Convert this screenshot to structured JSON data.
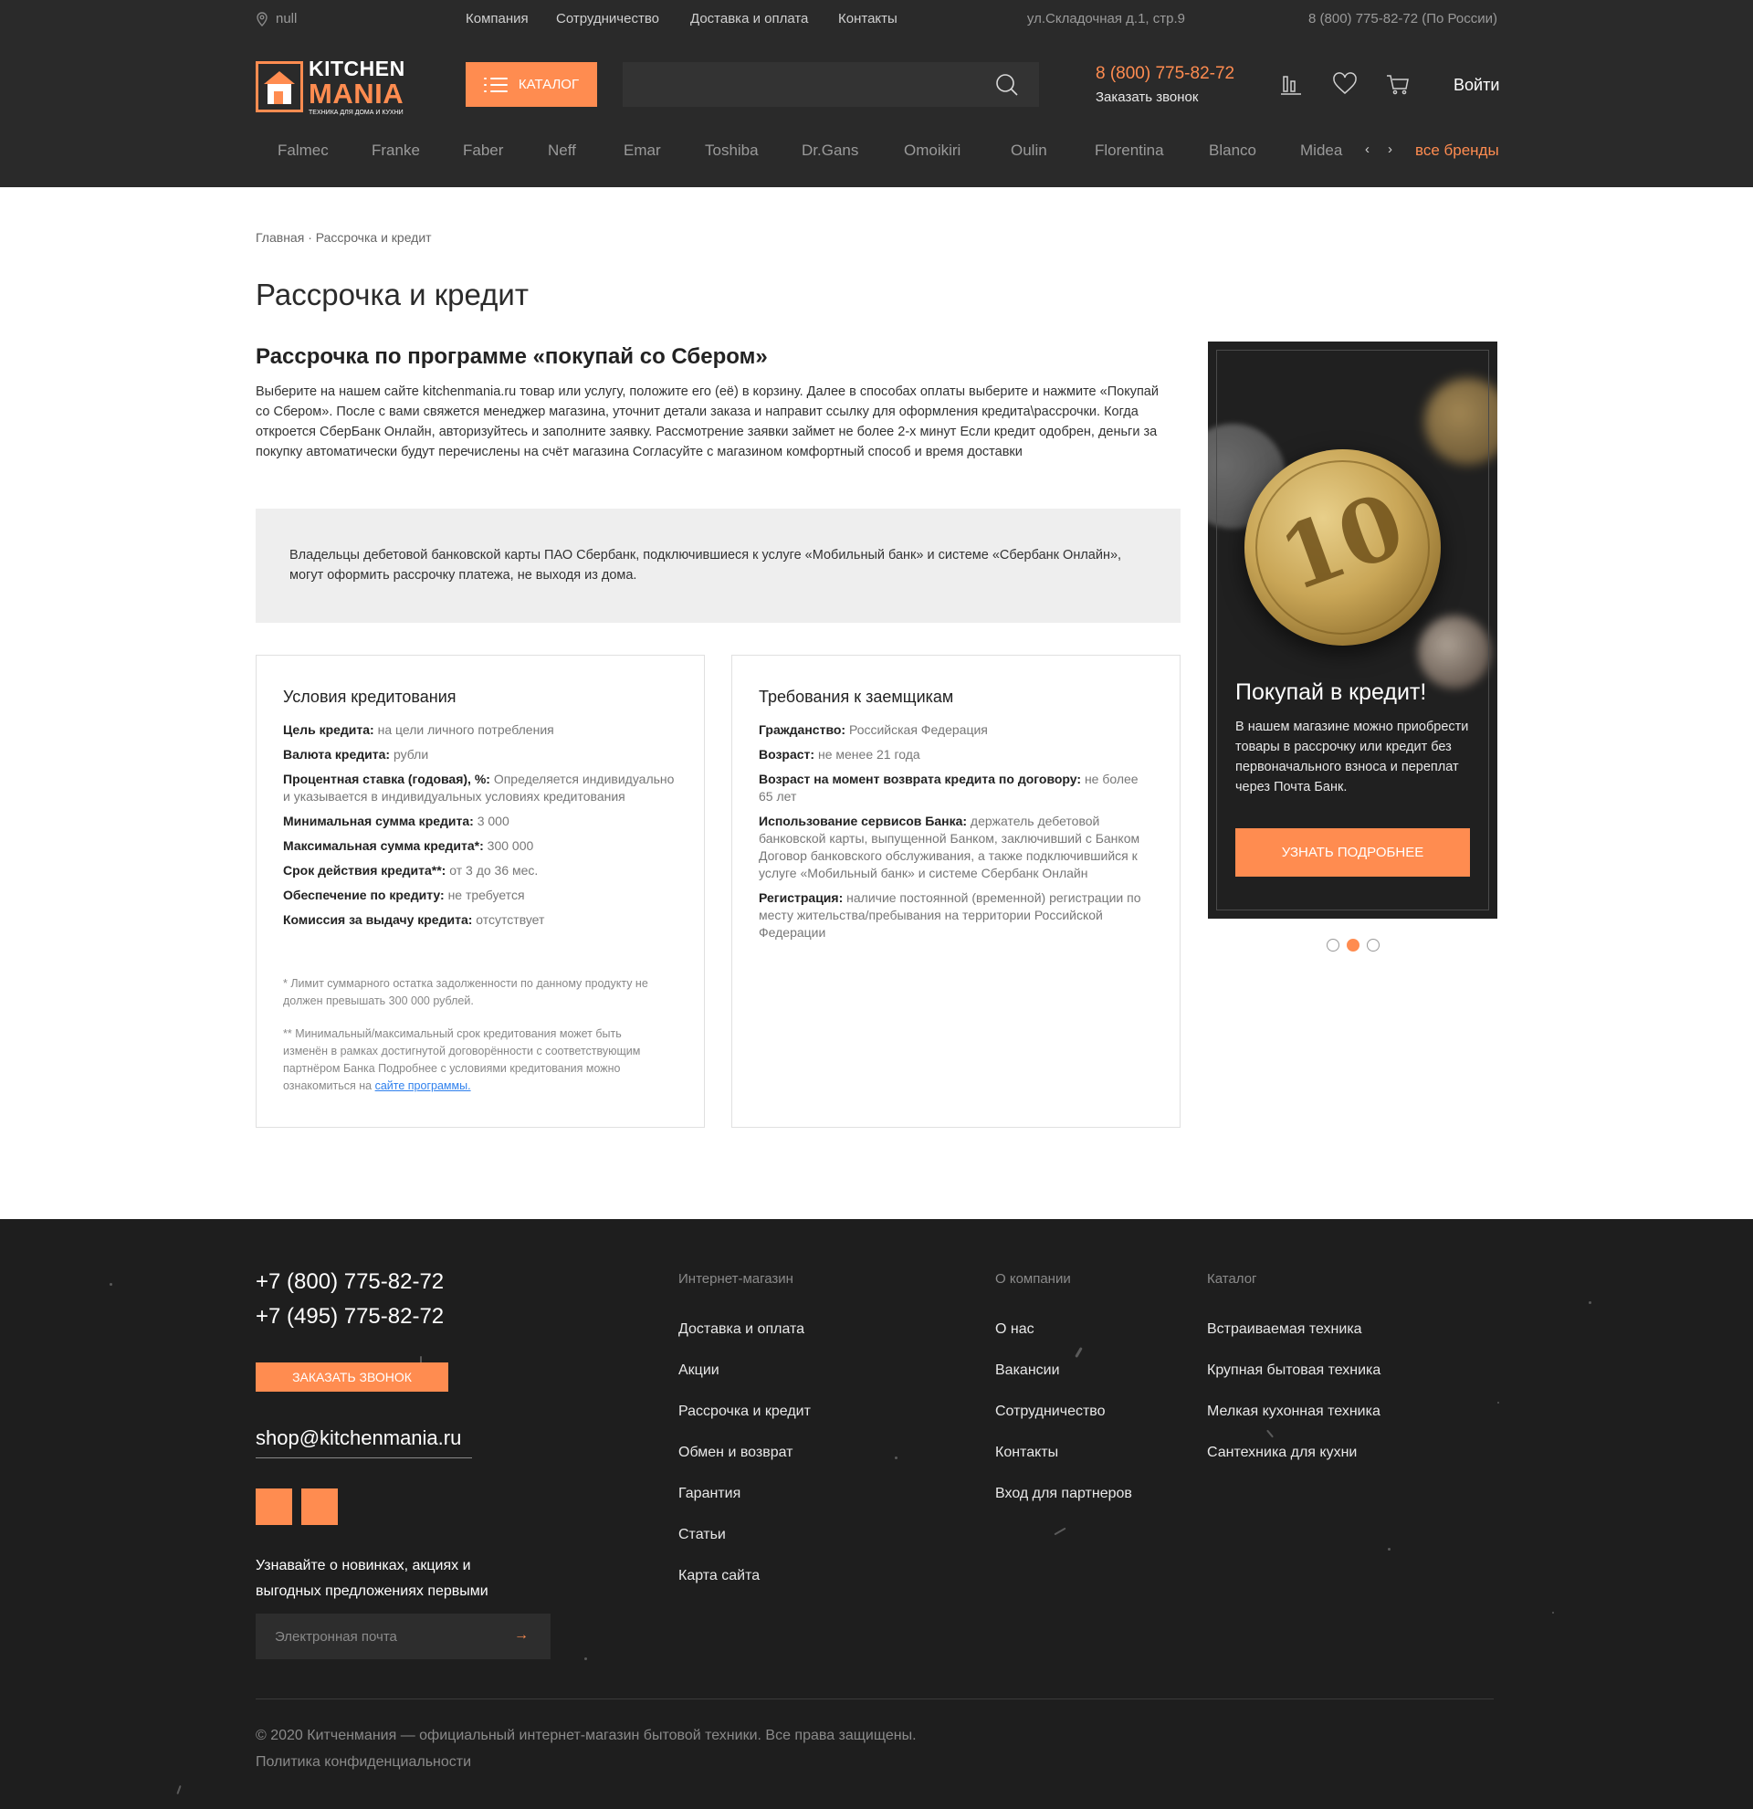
{
  "topbar": {
    "location": "null",
    "nav": [
      "Компания",
      "Сотрудничество",
      "Доставка и оплата",
      "Контакты"
    ],
    "address": "ул.Складочная д.1, стр.9",
    "phone": "8 (800) 775-82-72 (По России)"
  },
  "logo": {
    "line1": "KITCHEN",
    "line2": "MANIA",
    "tagline": "ТЕХНИКА ДЛЯ ДОМА И КУХНИ"
  },
  "header": {
    "catalog_label": "Каталог",
    "search_placeholder": "",
    "phone": "8 (800) 775-82-72",
    "callback": "Заказать звонок",
    "login": "Войти"
  },
  "brands": {
    "items": [
      "Falmec",
      "Franke",
      "Faber",
      "Neff",
      "Emar",
      "Toshiba",
      "Dr.Gans",
      "Omoikiri",
      "Oulin",
      "Florentina",
      "Blanco",
      "Midea"
    ],
    "prev": "‹",
    "next": "›",
    "all": "все бренды"
  },
  "breadcrumb": {
    "home": "Главная",
    "sep": "·",
    "current": "Рассрочка и кредит"
  },
  "page": {
    "title": "Рассрочка и кредит",
    "section_title": "Рассрочка по программе «покупай со Сбером»",
    "intro": "Выберите на нашем сайте kitchenmania.ru товар или услугу, положите его (её) в корзину. Далее в способах оплаты выберите и нажмите «Покупай со Сбером». После с вами свяжется менеджер магазина, уточнит детали заказа и направит ссылку для оформления кредита\\рассрочки. Когда откроется СберБанк Онлайн, авторизуйтесь и заполните заявку. Рассмотрение заявки займет не более 2-х минут Если кредит одобрен, деньги за покупку автоматически будут перечислены на счёт магазина Согласуйте с магазином комфортный способ и время доставки",
    "note": "Владельцы дебетовой банковской карты ПАО Сбербанк, подключившиеся к услуге «Мобильный банк» и системе «Сбербанк Онлайн», могут оформить рассрочку платежа, не выходя из дома."
  },
  "conditions": {
    "title": "Условия кредитования",
    "rows": [
      {
        "label": "Цель кредита:",
        "value": " на цели личного потребления"
      },
      {
        "label": "Валюта кредита:",
        "value": " рубли"
      },
      {
        "label": "Процентная ставка (годовая), %:",
        "value": " Определяется индивидуально и указывается в индивидуальных условиях кредитования"
      },
      {
        "label": "Минимальная сумма кредита:",
        "value": " 3 000"
      },
      {
        "label": "Максимальная сумма кредита*:",
        "value": " 300 000"
      },
      {
        "label": "Срок действия кредита**:",
        "value": " от 3 до 36 мес."
      },
      {
        "label": "Обеспечение по кредиту:",
        "value": " не требуется"
      },
      {
        "label": "Комиссия за выдачу кредита:",
        "value": " отсутствует"
      }
    ],
    "footnote1": "* Лимит суммарного остатка задолженности по данному продукту не должен превышать 300 000 рублей.",
    "footnote2": "** Минимальный/максимальный срок кредитования может быть изменён в рамках достигнутой договорённости с соответствующим партнёром Банка Подробнее с условиями кредитования можно ознакомиться на ",
    "footnote2_link": "сайте программы."
  },
  "requirements": {
    "title": "Требования к заемщикам",
    "rows": [
      {
        "label": "Гражданство:",
        "value": " Российская Федерация"
      },
      {
        "label": "Возраст:",
        "value": " не менее 21 года"
      },
      {
        "label": "Возраст на момент возврата кредита по договору:",
        "value": " не более 65 лет"
      },
      {
        "label": "Использование сервисов Банка:",
        "value": " держатель дебетовой банковской карты, выпущенной Банком, заключивший с Банком Договор банковского обслуживания, а также подключившийся к услуге «Мобильный банк» и системе Сбербанк Онлайн"
      },
      {
        "label": "Регистрация:",
        "value": " наличие постоянной (временной) регистрации по месту жительства/пребывания на территории Российской Федерации"
      }
    ]
  },
  "promo": {
    "coin": "10",
    "title": "Покупай в кредит!",
    "text": "В нашем магазине можно приобрести товары в рассрочку или кредит без первоначального взноса и переплат через Почта Банк.",
    "button": "Узнать подробнее",
    "slides": 3,
    "active_slide": 2
  },
  "footer": {
    "phone1": "+7 (800) 775-82-72",
    "phone2": "+7 (495) 775-82-72",
    "callback": "Заказать звонок",
    "email": "shop@kitchenmania.ru",
    "subscribe_text": "Узнавайте о новинках, акциях и выгодных предложениях первыми",
    "email_placeholder": "Электронная почта",
    "submit": "→",
    "col_shop_title": "Интернет-магазин",
    "col_shop": [
      "Доставка и оплата",
      "Акции",
      "Рассрочка и кредит",
      "Обмен и возврат",
      "Гарантия",
      "Статьи",
      "Карта сайта"
    ],
    "col_company_title": "О компании",
    "col_company": [
      "О нас",
      "Вакансии",
      "Сотрудничество",
      "Контакты",
      "Вход для партнеров"
    ],
    "col_catalog_title": "Каталог",
    "col_catalog": [
      "Встраиваемая техника",
      "Крупная бытовая техника",
      "Мелкая кухонная техника",
      "Сантехника для кухни"
    ],
    "copyright": "© 2020 Китченмания — официальный интернет-магазин бытовой техники. Все права защищены.",
    "policy": "Политика конфиденциальности"
  },
  "colors": {
    "accent": "#ff8c50",
    "header_bg": "#2a2a2a",
    "footer_bg": "#1e1e1e"
  }
}
